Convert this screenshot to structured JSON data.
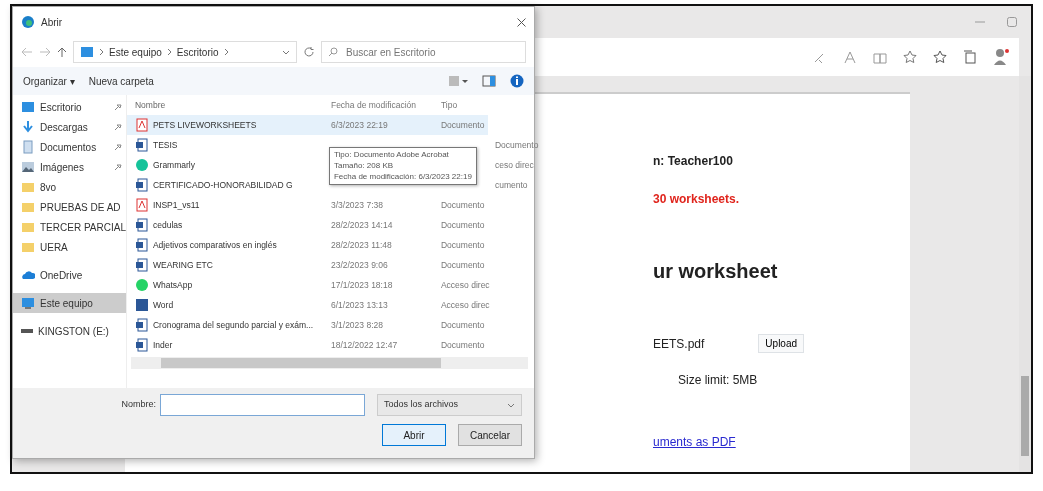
{
  "browser": {
    "page": {
      "lines": [
        {
          "kind": "text",
          "text": "n: Teacher100"
        },
        {
          "kind": "alert",
          "text": "30 worksheets."
        },
        {
          "kind": "heading",
          "text": "ur worksheet"
        },
        {
          "kind": "file",
          "text": "EETS.pdf",
          "button": "Upload"
        },
        {
          "kind": "note",
          "text": "Size limit: 5MB"
        },
        {
          "kind": "link",
          "text": "uments as PDF"
        }
      ]
    }
  },
  "dialog": {
    "title": "Abrir",
    "breadcrumb": [
      "Este equipo",
      "Escritorio"
    ],
    "search": {
      "placeholder": "Buscar en Escritorio"
    },
    "toolbar": [
      "Organizar ▾",
      "Nueva carpeta"
    ],
    "sidebar": [
      {
        "label": "Escritorio",
        "kind": "desktop",
        "pinned": true,
        "selected": false
      },
      {
        "label": "Descargas",
        "kind": "download",
        "pinned": true,
        "selected": false
      },
      {
        "label": "Documentos",
        "kind": "documents",
        "pinned": true,
        "selected": false
      },
      {
        "label": "Imágenes",
        "kind": "pictures",
        "pinned": true,
        "selected": false
      },
      {
        "label": "8vo",
        "kind": "folder",
        "pinned": false,
        "selected": false
      },
      {
        "label": "PRUEBAS DE AD",
        "kind": "folder",
        "pinned": false,
        "selected": false
      },
      {
        "label": "TERCER PARCIAL",
        "kind": "folder",
        "pinned": false,
        "selected": false
      },
      {
        "label": "UERA",
        "kind": "folder",
        "pinned": false,
        "selected": false
      },
      {
        "label": "OneDrive",
        "kind": "cloud",
        "pinned": false,
        "selected": false
      },
      {
        "label": "Este equipo",
        "kind": "computer",
        "pinned": false,
        "selected": true
      },
      {
        "label": "KINGSTON (E:)",
        "kind": "drive",
        "pinned": false,
        "selected": false
      }
    ],
    "columns": [
      "Nombre",
      "Fecha de modificación",
      "Tipo"
    ],
    "files": [
      {
        "name": "PETS LIVEWORKSHEETS",
        "date": "6/3/2023 22:19",
        "type": "Documento",
        "kind": "pdf",
        "selected": true
      },
      {
        "name": "TESIS",
        "type": "Documento",
        "kind": "word",
        "selected": false
      },
      {
        "name": "Grammarly",
        "type": "ceso direc",
        "kind": "app",
        "selected": false
      },
      {
        "name": "CERTIFICADO-HONORABILIDAD G",
        "type": "cumento",
        "kind": "word",
        "selected": false
      },
      {
        "name": "INSP1_vs11",
        "date": "3/3/2023 7:38",
        "type": "Documento",
        "kind": "pdf",
        "selected": false
      },
      {
        "name": "cedulas",
        "date": "28/2/2023 14:14",
        "type": "Documento",
        "kind": "word",
        "selected": false
      },
      {
        "name": "Adjetivos comparativos en inglés",
        "date": "28/2/2023 11:48",
        "type": "Documento",
        "kind": "word",
        "selected": false
      },
      {
        "name": "WEARING ETC",
        "date": "23/2/2023 9:06",
        "type": "Documento",
        "kind": "word",
        "selected": false
      },
      {
        "name": "WhatsApp",
        "date": "17/1/2023 18:18",
        "type": "Acceso direc",
        "kind": "chat",
        "selected": false
      },
      {
        "name": "Word",
        "date": "6/1/2023 13:13",
        "type": "Acceso direc",
        "kind": "wordapp",
        "selected": false
      },
      {
        "name": "Cronograma del segundo parcial y exám...",
        "date": "3/1/2023 8:28",
        "type": "Documento",
        "kind": "word",
        "selected": false
      },
      {
        "name": "Inder",
        "date": "18/12/2022 12:47",
        "type": "Documento",
        "kind": "word",
        "selected": false
      }
    ],
    "tooltip": [
      "Tipo: Documento Adobe Acrobat",
      "Tamaño: 208 KB",
      "Fecha de modificación: 6/3/2023 22:19"
    ],
    "filename": {
      "label": "Nombre:"
    },
    "filter": "Todos los archivos",
    "buttons": [
      "Abrir",
      "Cancelar"
    ]
  }
}
